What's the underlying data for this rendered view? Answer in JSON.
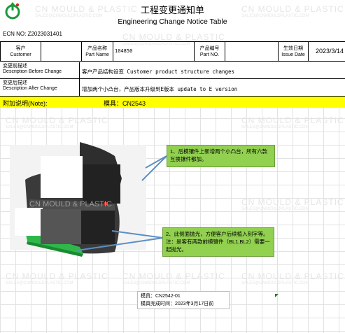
{
  "header": {
    "title_cn": "工程变更通知单",
    "title_en": "Engineering Change Notice Table",
    "ecn_no": "ECN NO: Z2023031401"
  },
  "watermark": {
    "text": "CN MOULD & PLASTIC",
    "sub": "SALES@CNMOULDPLASTIC.COM"
  },
  "info_table": {
    "customer_label_cn": "客户",
    "customer_label_en": "Customer",
    "customer_value": "",
    "part_name_label_cn": "产品名称",
    "part_name_label_en": "Part Name",
    "part_name_value": "104850",
    "part_no_label_cn": "产品编号",
    "part_no_label_en": "Part NO.",
    "part_no_value": "",
    "issue_date_label_cn": "生效日期",
    "issue_date_label_en": "Issue Date",
    "issue_date_value": "2023/3/14"
  },
  "before": {
    "label_cn": "变更前描述",
    "label_en": "Description Before Change",
    "text": "客户产品结构设变 Customer product structure changes"
  },
  "after": {
    "label_cn": "变更后描述",
    "label_en": "Description After Change",
    "text": "增加两个小凸台，产品版本升级到E版本 update to E version"
  },
  "note": {
    "label": "附加说明(Note):",
    "mould": "模具：CN2543"
  },
  "callouts": {
    "one": "1、后模镶件上新增两个小凸台，所有六款互换镶件都加。",
    "two": "2、此侧面抛光，方便客户后续植入刻字等。注：是客有两款前模镶件（BL1,BL2）需要一起抛光。"
  },
  "annotation": {
    "line1": "模具：CN2542-01",
    "line2": "模具完成时间：2023年3月17日前"
  },
  "colors": {
    "note_bg": "#ffff00",
    "callout_bg": "#92d050",
    "part_green": "#2fb84a",
    "arrow_blue": "#5b8fc7"
  }
}
